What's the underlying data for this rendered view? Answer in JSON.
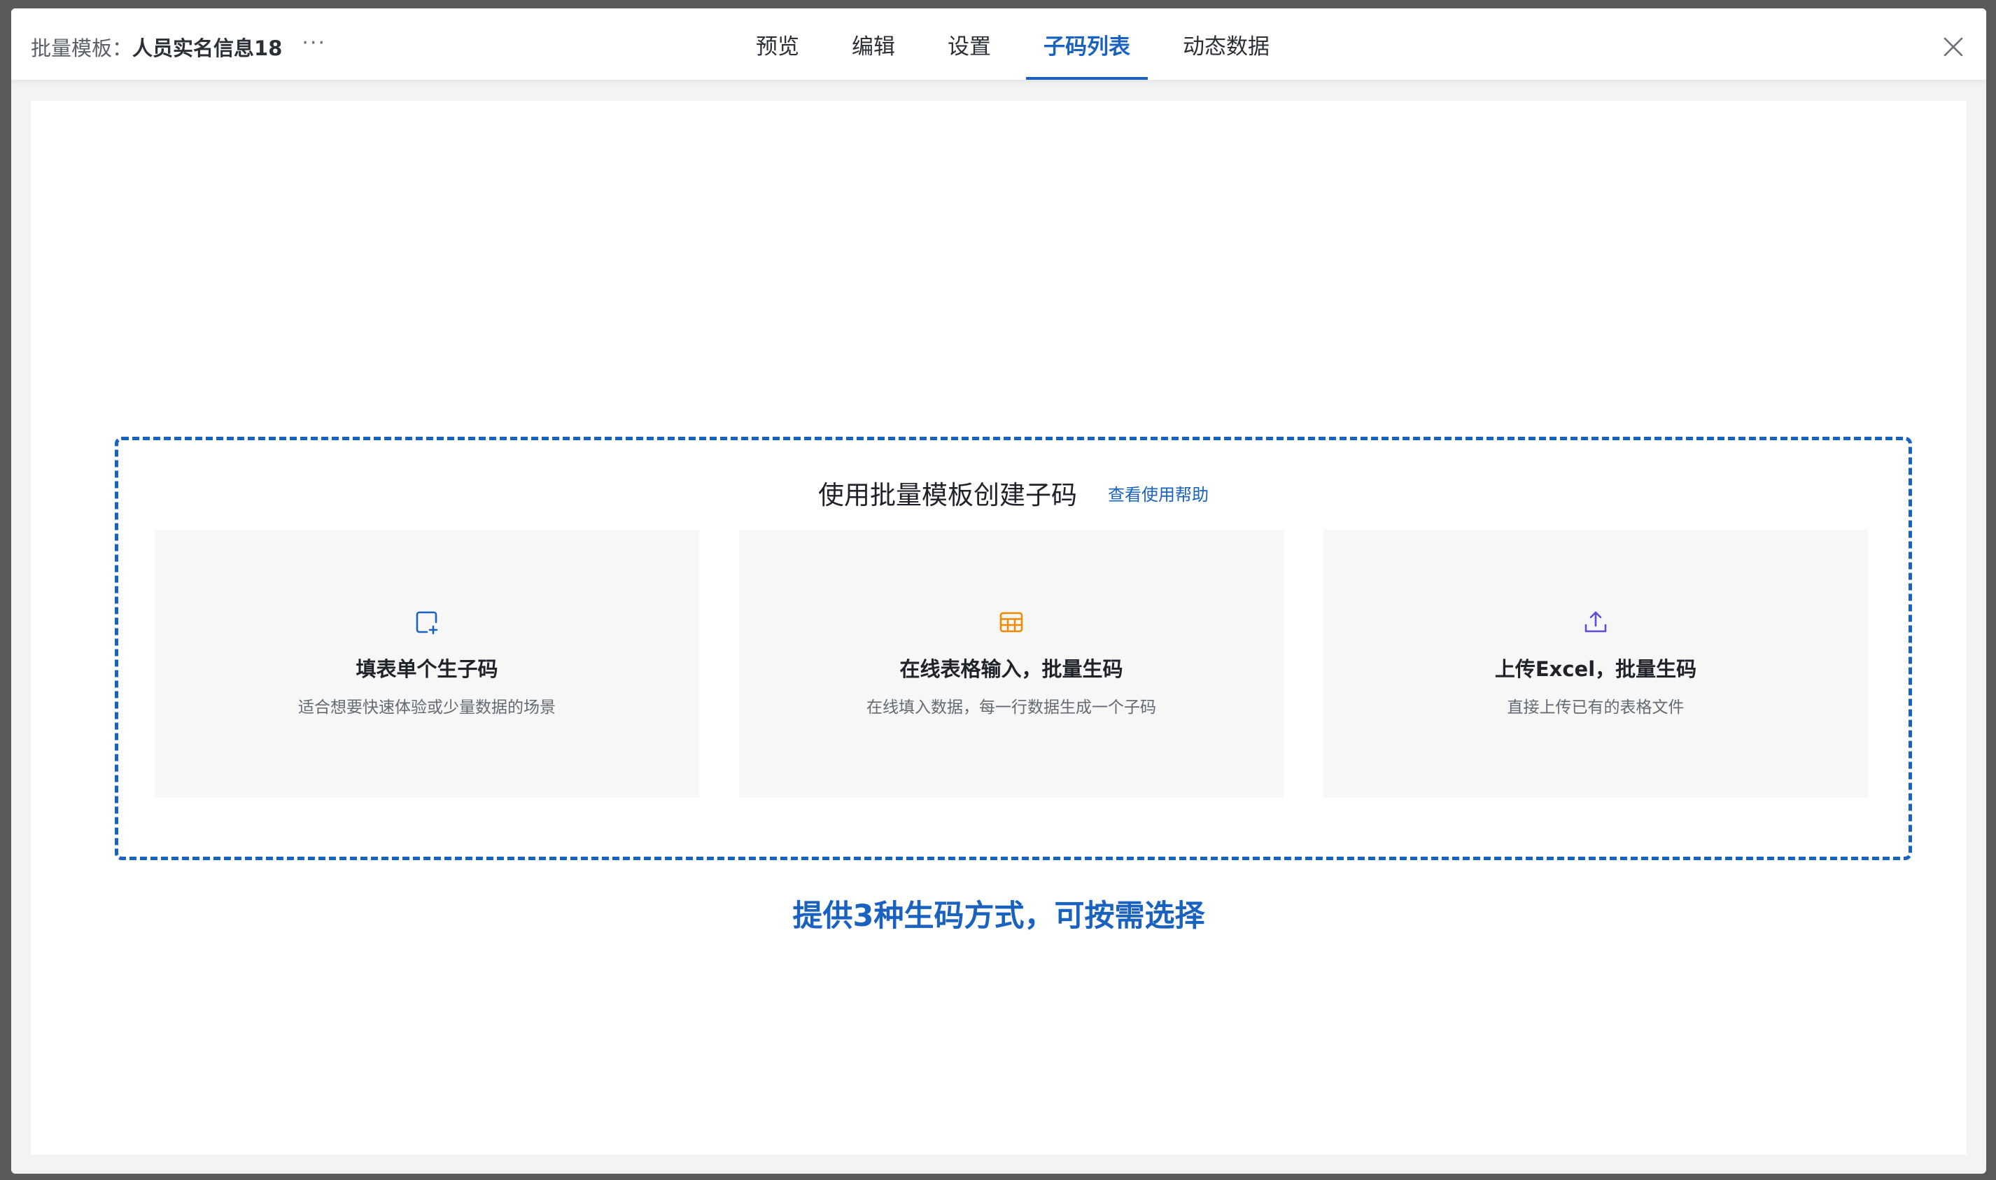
{
  "header": {
    "title_prefix": "批量模板：",
    "title_name": "人员实名信息18",
    "more_label": "···",
    "tabs": [
      {
        "label": "预览",
        "active": false
      },
      {
        "label": "编辑",
        "active": false
      },
      {
        "label": "设置",
        "active": false
      },
      {
        "label": "子码列表",
        "active": true
      },
      {
        "label": "动态数据",
        "active": false
      }
    ],
    "close_icon": "close-icon"
  },
  "section": {
    "title": "使用批量模板创建子码",
    "help_link": "查看使用帮助"
  },
  "cards": [
    {
      "icon": "add-form-icon",
      "icon_color": "#1a62bf",
      "title": "填表单个生子码",
      "desc": "适合想要快速体验或少量数据的场景"
    },
    {
      "icon": "table-icon",
      "icon_color": "#f08a00",
      "title": "在线表格输入，批量生码",
      "desc": "在线填入数据，每一行数据生成一个子码"
    },
    {
      "icon": "upload-icon",
      "icon_color": "#5b4fd8",
      "title": "上传Excel，批量生码",
      "desc": "直接上传已有的表格文件"
    }
  ],
  "caption": "提供3种生码方式，可按需选择",
  "colors": {
    "accent": "#1a62bf",
    "card_bg": "#f7f7f7",
    "text": "#1f2329"
  }
}
